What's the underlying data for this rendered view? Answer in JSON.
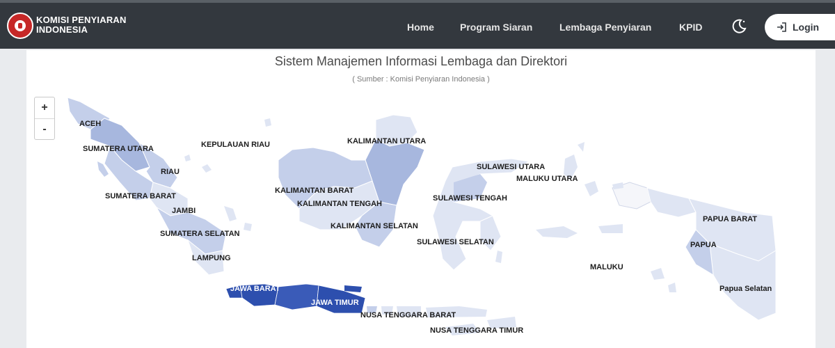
{
  "header": {
    "brand_line1": "KOMISI PENYIARAN",
    "brand_line2": "INDONESIA",
    "nav": [
      "Home",
      "Program Siaran",
      "Lembaga Penyiaran",
      "KPID"
    ],
    "login_label": "Login"
  },
  "map": {
    "title": "Sistem Manajemen Informasi Lembaga dan Direktori",
    "subtitle": "( Sumber : Komisi Penyiaran Indonesia )",
    "zoom_in": "+",
    "zoom_out": "-",
    "colors": {
      "light": "#dfe5f3",
      "mid": "#c4cfea",
      "dark": "#a7b7de",
      "java": "#2d4fae"
    },
    "labels": {
      "aceh": "ACEH",
      "sumut": "SUMATERA UTARA",
      "kepri": "KEPULAUAN RIAU",
      "riau": "RIAU",
      "sumbar": "SUMATERA BARAT",
      "jambi": "JAMBI",
      "sumsel": "SUMATERA SELATAN",
      "lampung": "LAMPUNG",
      "kaltara": "KALIMANTAN UTARA",
      "kalbar": "KALIMANTAN BARAT",
      "kalteng": "KALIMANTAN TENGAH",
      "kalsel": "KALIMANTAN SELATAN",
      "sulut": "SULAWESI UTARA",
      "malut": "MALUKU UTARA",
      "sulteng": "SULAWESI TENGAH",
      "sulsel": "SULAWESI SELATAN",
      "maluku": "MALUKU",
      "papbar": "PAPUA BARAT",
      "papua": "PAPUA",
      "papsel": "Papua Selatan",
      "jabar": "JAWA BARAT",
      "jatim": "JAWA TIMUR",
      "ntb": "NUSA TENGGARA BARAT",
      "ntt": "NUSA TENGGARA TIMUR"
    }
  }
}
